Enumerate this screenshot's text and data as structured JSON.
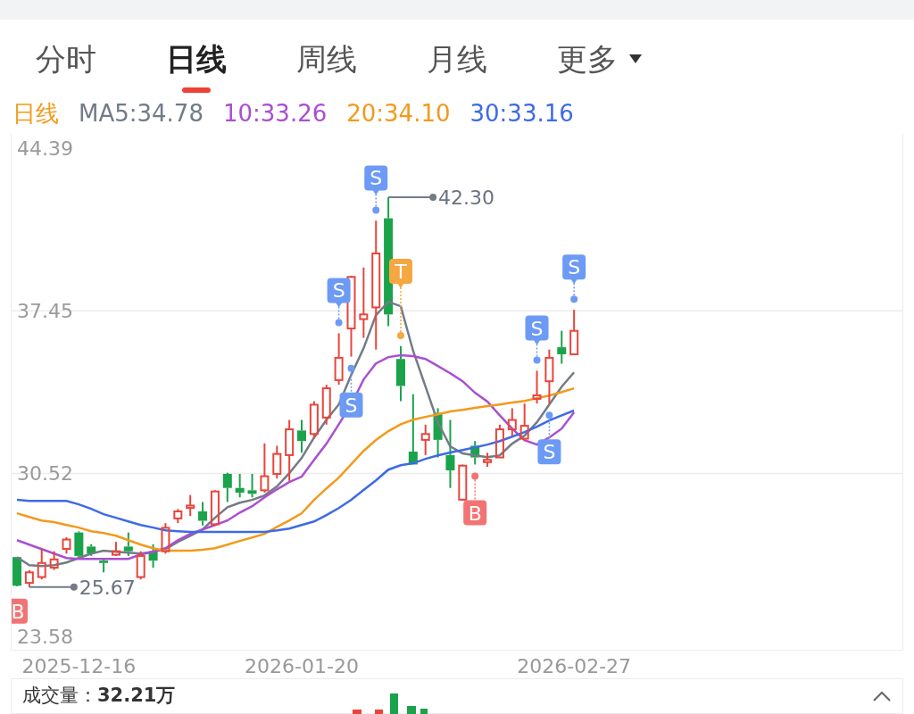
{
  "tabs": [
    {
      "label": "分时",
      "selected": false
    },
    {
      "label": "日线",
      "selected": true
    },
    {
      "label": "周线",
      "selected": false
    },
    {
      "label": "月线",
      "selected": false
    },
    {
      "label": "更多",
      "selected": false,
      "kind": "dropdown"
    }
  ],
  "legend": {
    "period": "日线"
  },
  "chart": {
    "annotation_styles": [
      {
        "kind": "high_line"
      },
      {
        "kind": "low_line"
      },
      {
        "kind": "badge",
        "color": "#f27373"
      },
      {
        "kind": "badge",
        "color": "#6d9af5"
      },
      {
        "kind": "badge",
        "color": "#6d9af5"
      },
      {
        "kind": "badge",
        "color": "#6d9af5"
      },
      {
        "kind": "badge",
        "color": "#f5a742"
      },
      {
        "kind": "badge",
        "color": "#f27373"
      },
      {
        "kind": "badge",
        "color": "#6d9af5"
      },
      {
        "kind": "badge",
        "color": "#6d9af5"
      },
      {
        "kind": "badge",
        "color": "#6d9af5"
      }
    ],
    "chart_data": {
      "type": "candlestick",
      "ylim": [
        23.0,
        45.0
      ],
      "yticks": [
        {
          "value": 44.39,
          "label": "44.39"
        },
        {
          "value": 37.45,
          "label": "37.45"
        },
        {
          "value": 30.52,
          "label": "30.52"
        },
        {
          "value": 23.58,
          "label": "23.58"
        }
      ],
      "categories": [
        null,
        null,
        null,
        null,
        null,
        "2025-12-16",
        null,
        null,
        null,
        null,
        null,
        null,
        null,
        null,
        null,
        null,
        null,
        null,
        null,
        null,
        null,
        null,
        null,
        "2026-01-20",
        null,
        null,
        null,
        null,
        null,
        null,
        null,
        null,
        null,
        null,
        null,
        null,
        null,
        null,
        null,
        null,
        null,
        null,
        null,
        null,
        null,
        "2026-02-27"
      ],
      "ohlc": [
        [
          26.95,
          26.95,
          25.7,
          25.73
        ],
        [
          25.85,
          26.4,
          25.67,
          26.3
        ],
        [
          26.1,
          27.3,
          26.0,
          26.7
        ],
        [
          26.5,
          27.2,
          26.4,
          26.85
        ],
        [
          27.3,
          27.8,
          27.1,
          27.7
        ],
        [
          28.0,
          28.05,
          26.9,
          27.0
        ],
        [
          27.4,
          27.5,
          27.0,
          27.1
        ],
        [
          26.8,
          26.9,
          26.3,
          26.7
        ],
        [
          27.05,
          27.6,
          27.0,
          27.2
        ],
        [
          27.4,
          28.0,
          27.0,
          27.2
        ],
        [
          26.1,
          27.2,
          26.0,
          27.0
        ],
        [
          27.2,
          27.5,
          26.5,
          26.8
        ],
        [
          27.2,
          28.4,
          27.1,
          28.2
        ],
        [
          28.6,
          29.0,
          28.4,
          28.9
        ],
        [
          29.05,
          29.6,
          28.7,
          29.15
        ],
        [
          28.9,
          29.3,
          28.3,
          28.5
        ],
        [
          28.35,
          29.8,
          28.3,
          29.75
        ],
        [
          30.5,
          30.55,
          29.3,
          29.9
        ],
        [
          29.9,
          30.5,
          29.5,
          29.7
        ],
        [
          29.8,
          30.5,
          29.5,
          29.65
        ],
        [
          29.8,
          31.8,
          29.7,
          30.4
        ],
        [
          30.5,
          31.7,
          30.3,
          31.35
        ],
        [
          31.3,
          32.8,
          30.2,
          32.4
        ],
        [
          32.35,
          32.8,
          31.4,
          31.9
        ],
        [
          32.2,
          33.6,
          32.0,
          33.45
        ],
        [
          32.9,
          34.3,
          32.6,
          34.15
        ],
        [
          34.5,
          36.5,
          34.3,
          35.45
        ],
        [
          36.7,
          38.95,
          35.5,
          38.9
        ],
        [
          37.1,
          39.3,
          36.3,
          37.3
        ],
        [
          37.6,
          41.3,
          35.8,
          39.9
        ],
        [
          41.4,
          42.3,
          36.8,
          37.3
        ],
        [
          35.4,
          35.95,
          33.6,
          34.25
        ],
        [
          31.45,
          33.9,
          30.9,
          30.9
        ],
        [
          31.95,
          32.6,
          31.3,
          32.2
        ],
        [
          33.1,
          33.3,
          31.2,
          31.95
        ],
        [
          31.3,
          32.8,
          29.9,
          30.65
        ],
        [
          29.4,
          30.9,
          29.35,
          30.85
        ],
        [
          31.7,
          31.9,
          30.9,
          31.2
        ],
        [
          31.0,
          31.4,
          30.8,
          31.1
        ],
        [
          31.2,
          32.6,
          31.2,
          32.4
        ],
        [
          32.4,
          33.3,
          32.1,
          32.8
        ],
        [
          32.0,
          33.5,
          31.9,
          32.55
        ],
        [
          33.7,
          34.9,
          33.5,
          33.85
        ],
        [
          34.45,
          35.8,
          33.5,
          35.45
        ],
        [
          35.9,
          36.6,
          35.2,
          35.6
        ],
        [
          35.6,
          37.5,
          35.6,
          36.6
        ]
      ],
      "series": [
        {
          "name": "MA5:34.78",
          "type": "line",
          "color": "#737b87",
          "values": [
            26.95,
            26.61,
            26.57,
            26.61,
            26.72,
            26.91,
            27.1,
            27.22,
            27.18,
            27.14,
            27.1,
            27.18,
            27.29,
            27.6,
            27.86,
            28.13,
            28.63,
            29.08,
            29.27,
            29.39,
            29.58,
            29.96,
            30.53,
            31.18,
            32.05,
            32.81,
            33.46,
            34.72,
            35.86,
            37.27,
            37.84,
            37.65,
            35.75,
            34.22,
            32.7,
            31.67,
            31.37,
            31.29,
            31.21,
            31.29,
            31.79,
            32.13,
            32.7,
            33.46,
            34.22,
            34.83
          ]
        },
        {
          "name": "10:33.26",
          "type": "line",
          "color": "#a94fd1",
          "values": [
            27.67,
            27.48,
            27.29,
            27.1,
            26.91,
            26.87,
            26.87,
            26.87,
            26.87,
            26.87,
            27.06,
            27.18,
            27.33,
            27.67,
            27.94,
            28.13,
            28.32,
            28.51,
            28.85,
            29.12,
            29.5,
            29.84,
            30.15,
            30.38,
            31.1,
            31.79,
            32.62,
            33.46,
            34.53,
            35.21,
            35.48,
            35.56,
            35.52,
            35.4,
            35.1,
            34.79,
            34.45,
            33.96,
            33.58,
            33.0,
            32.43,
            31.94,
            31.75,
            32.05,
            32.43,
            33.12
          ]
        },
        {
          "name": "20:34.10",
          "type": "line",
          "color": "#f29a1c",
          "values": [
            28.82,
            28.66,
            28.51,
            28.44,
            28.32,
            28.21,
            28.05,
            27.98,
            27.86,
            27.67,
            27.48,
            27.33,
            27.22,
            27.22,
            27.22,
            27.26,
            27.33,
            27.48,
            27.64,
            27.79,
            27.94,
            28.24,
            28.51,
            28.82,
            29.39,
            29.88,
            30.34,
            30.91,
            31.48,
            31.94,
            32.32,
            32.62,
            32.81,
            32.93,
            33.04,
            33.16,
            33.23,
            33.31,
            33.39,
            33.46,
            33.54,
            33.61,
            33.73,
            33.84,
            33.99,
            34.15
          ]
        },
        {
          "name": "30:33.16",
          "type": "line",
          "color": "#3d6be6",
          "values": [
            29.39,
            29.35,
            29.35,
            29.35,
            29.35,
            29.2,
            29.01,
            28.78,
            28.63,
            28.47,
            28.32,
            28.21,
            28.09,
            28.05,
            28.02,
            28.02,
            28.02,
            28.02,
            28.02,
            28.02,
            28.02,
            28.09,
            28.17,
            28.32,
            28.47,
            28.74,
            29.04,
            29.39,
            29.81,
            30.22,
            30.68,
            30.87,
            30.95,
            31.14,
            31.29,
            31.41,
            31.52,
            31.63,
            31.75,
            31.9,
            32.09,
            32.28,
            32.51,
            32.78,
            33.0,
            33.2
          ]
        }
      ],
      "annotations": [
        "42.30",
        "25.67",
        "B",
        "S",
        "S",
        "S",
        "T",
        "B",
        "S",
        "S",
        "S"
      ]
    }
  },
  "volume": {
    "label": "成交量：**32.21万**"
  }
}
